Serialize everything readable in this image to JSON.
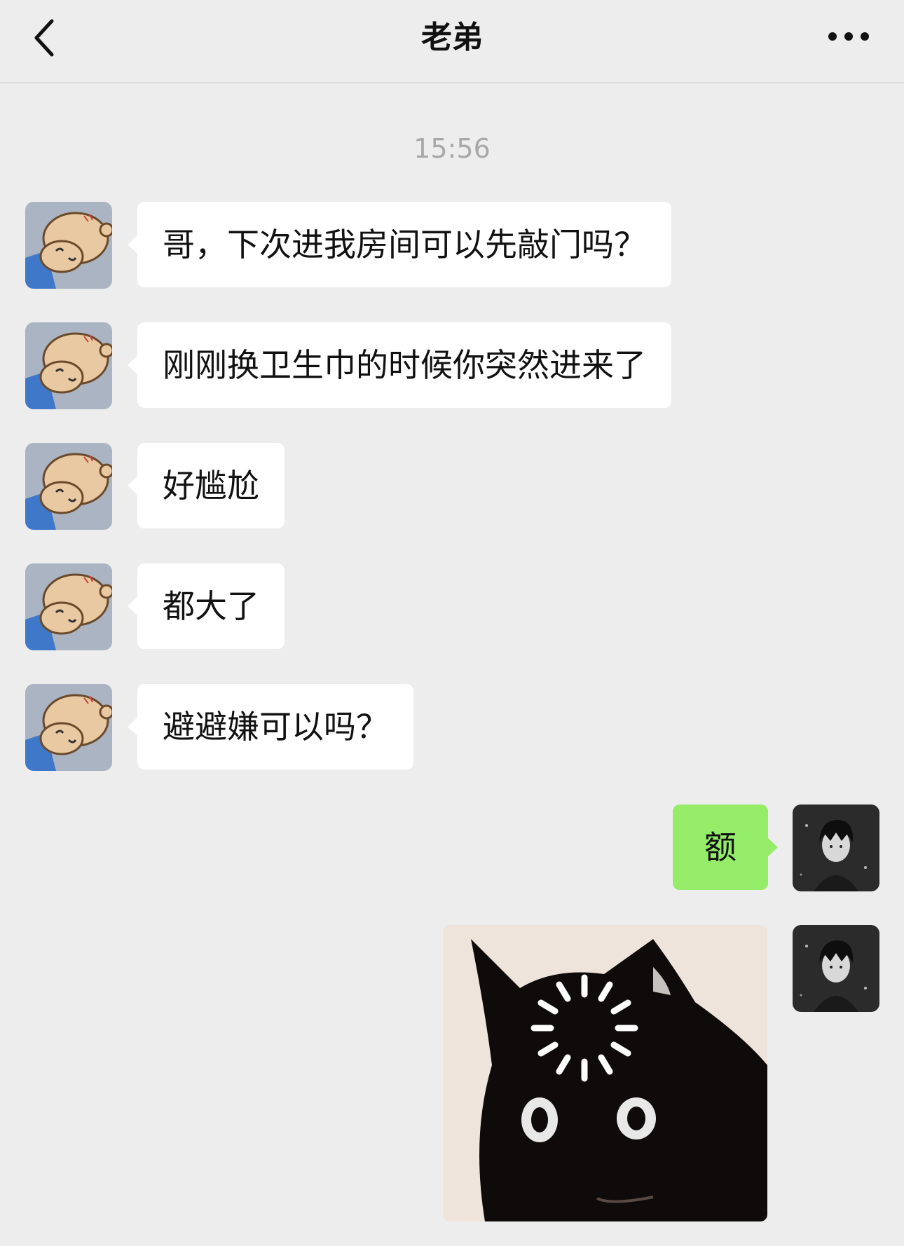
{
  "header": {
    "title": "老弟",
    "back_icon": "chevron-left-icon",
    "more_icon": "more-dots-icon"
  },
  "chat": {
    "timestamp": "15:56",
    "messages": [
      {
        "side": "left",
        "text": "哥，下次进我房间可以先敲门吗？"
      },
      {
        "side": "left",
        "text": "刚刚换卫生巾的时候你突然进来了"
      },
      {
        "side": "left",
        "text": "好尴尬"
      },
      {
        "side": "left",
        "text": "都大了"
      },
      {
        "side": "left",
        "text": "避避嫌可以吗？"
      },
      {
        "side": "right",
        "text": "额"
      },
      {
        "side": "right",
        "type": "sticker",
        "description_icon": "black-cat-loading-sticker"
      }
    ]
  },
  "colors": {
    "background": "#ededed",
    "incoming_bubble": "#ffffff",
    "outgoing_bubble": "#95ec69",
    "timestamp": "#a8a8a8"
  }
}
